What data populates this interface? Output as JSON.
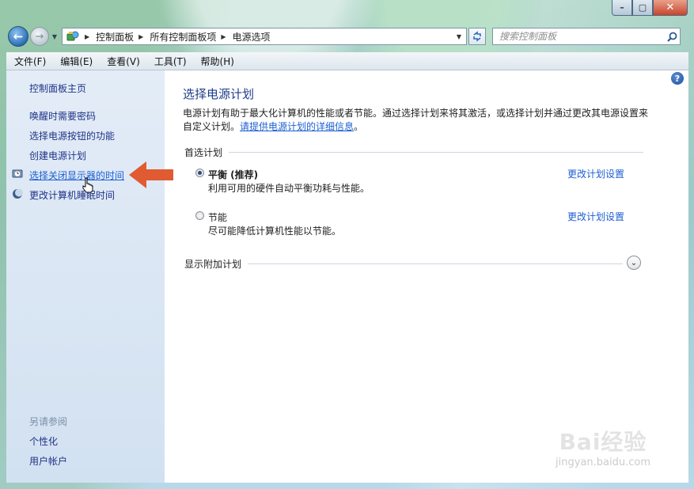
{
  "window": {
    "caption_buttons": [
      "minimize",
      "maximize",
      "close"
    ],
    "close_glyph": "✕",
    "max_glyph": "▢",
    "min_glyph": "–"
  },
  "nav": {
    "back_glyph": "←",
    "forward_glyph": "→",
    "breadcrumbs": [
      "控制面板",
      "所有控制面板项",
      "电源选项"
    ],
    "search_placeholder": "搜索控制面板"
  },
  "menu": {
    "items": [
      "文件(F)",
      "编辑(E)",
      "查看(V)",
      "工具(T)",
      "帮助(H)"
    ]
  },
  "sidebar": {
    "home": "控制面板主页",
    "tasks": [
      "唤醒时需要密码",
      "选择电源按钮的功能",
      "创建电源计划",
      "选择关闭显示器的时间",
      "更改计算机睡眠时间"
    ],
    "see_also_title": "另请参阅",
    "see_also": [
      "个性化",
      "用户帐户"
    ]
  },
  "main": {
    "help_glyph": "?",
    "title": "选择电源计划",
    "desc_text": "电源计划有助于最大化计算机的性能或者节能。通过选择计划来将其激活，或选择计划并通过更改其电源设置来自定义计划。",
    "desc_link": "请提供电源计划的详细信息",
    "desc_end": "。",
    "preferred_group": "首选计划",
    "plans": [
      {
        "name": "平衡 (推荐)",
        "desc": "利用可用的硬件自动平衡功耗与性能。",
        "selected": true,
        "link": "更改计划设置"
      },
      {
        "name": "节能",
        "desc": "尽可能降低计算机性能以节能。",
        "selected": false,
        "link": "更改计划设置"
      }
    ],
    "additional_group": "显示附加计划"
  },
  "watermark": {
    "logo": "Bai经验",
    "url": "jingyan.baidu.com"
  },
  "colors": {
    "link": "#1d5fd1",
    "title": "#1e3c89",
    "arrow": "#e05a32"
  }
}
